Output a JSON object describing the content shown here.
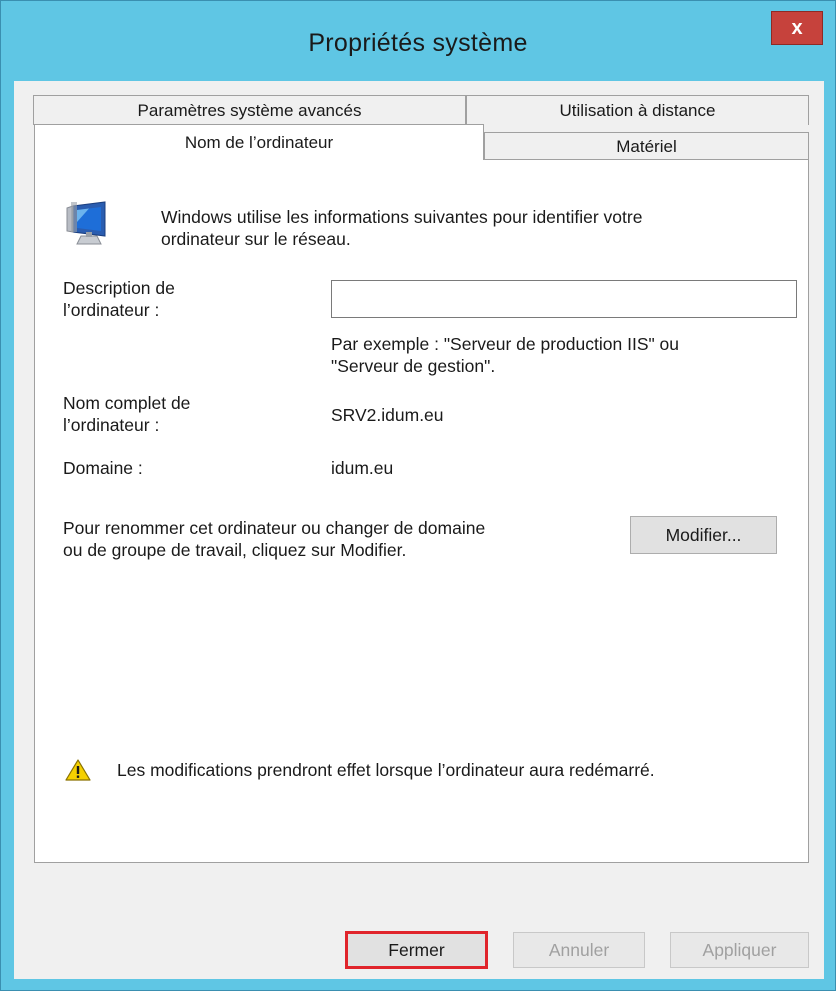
{
  "window": {
    "title": "Propriétés système",
    "close_label": "x"
  },
  "tabs": {
    "advanced": "Paramètres système avancés",
    "remote": "Utilisation à distance",
    "computer_name": "Nom de l’ordinateur",
    "hardware": "Matériel"
  },
  "panel": {
    "intro_line1": "Windows utilise les informations suivantes pour identifier votre",
    "intro_line2": "ordinateur sur le réseau.",
    "description_label_line1": "Description de",
    "description_label_line2": "l’ordinateur :",
    "description_value": "",
    "description_placeholder": "",
    "example_line1": "Par exemple : \"Serveur de production IIS\" ou",
    "example_line2": "\"Serveur de gestion\".",
    "fullname_label_line1": "Nom complet de",
    "fullname_label_line2": "l’ordinateur :",
    "fullname_value": "SRV2.idum.eu",
    "domain_label": "Domaine :",
    "domain_value": "idum.eu",
    "rename_line1": "Pour renommer cet ordinateur ou changer de domaine",
    "rename_line2": "ou de groupe de travail, cliquez sur Modifier.",
    "modify_button": "Modifier...",
    "warning_text": "Les modifications prendront effet lorsque l’ordinateur aura redémarré."
  },
  "footer": {
    "close_button": "Fermer",
    "cancel_button": "Annuler",
    "apply_button": "Appliquer"
  },
  "colors": {
    "titlebar": "#5fc6e4",
    "close_button": "#c6423c",
    "focus_highlight": "#e0242b"
  },
  "icons": {
    "computer": "computer-monitor-icon",
    "warning": "warning-triangle-icon"
  }
}
